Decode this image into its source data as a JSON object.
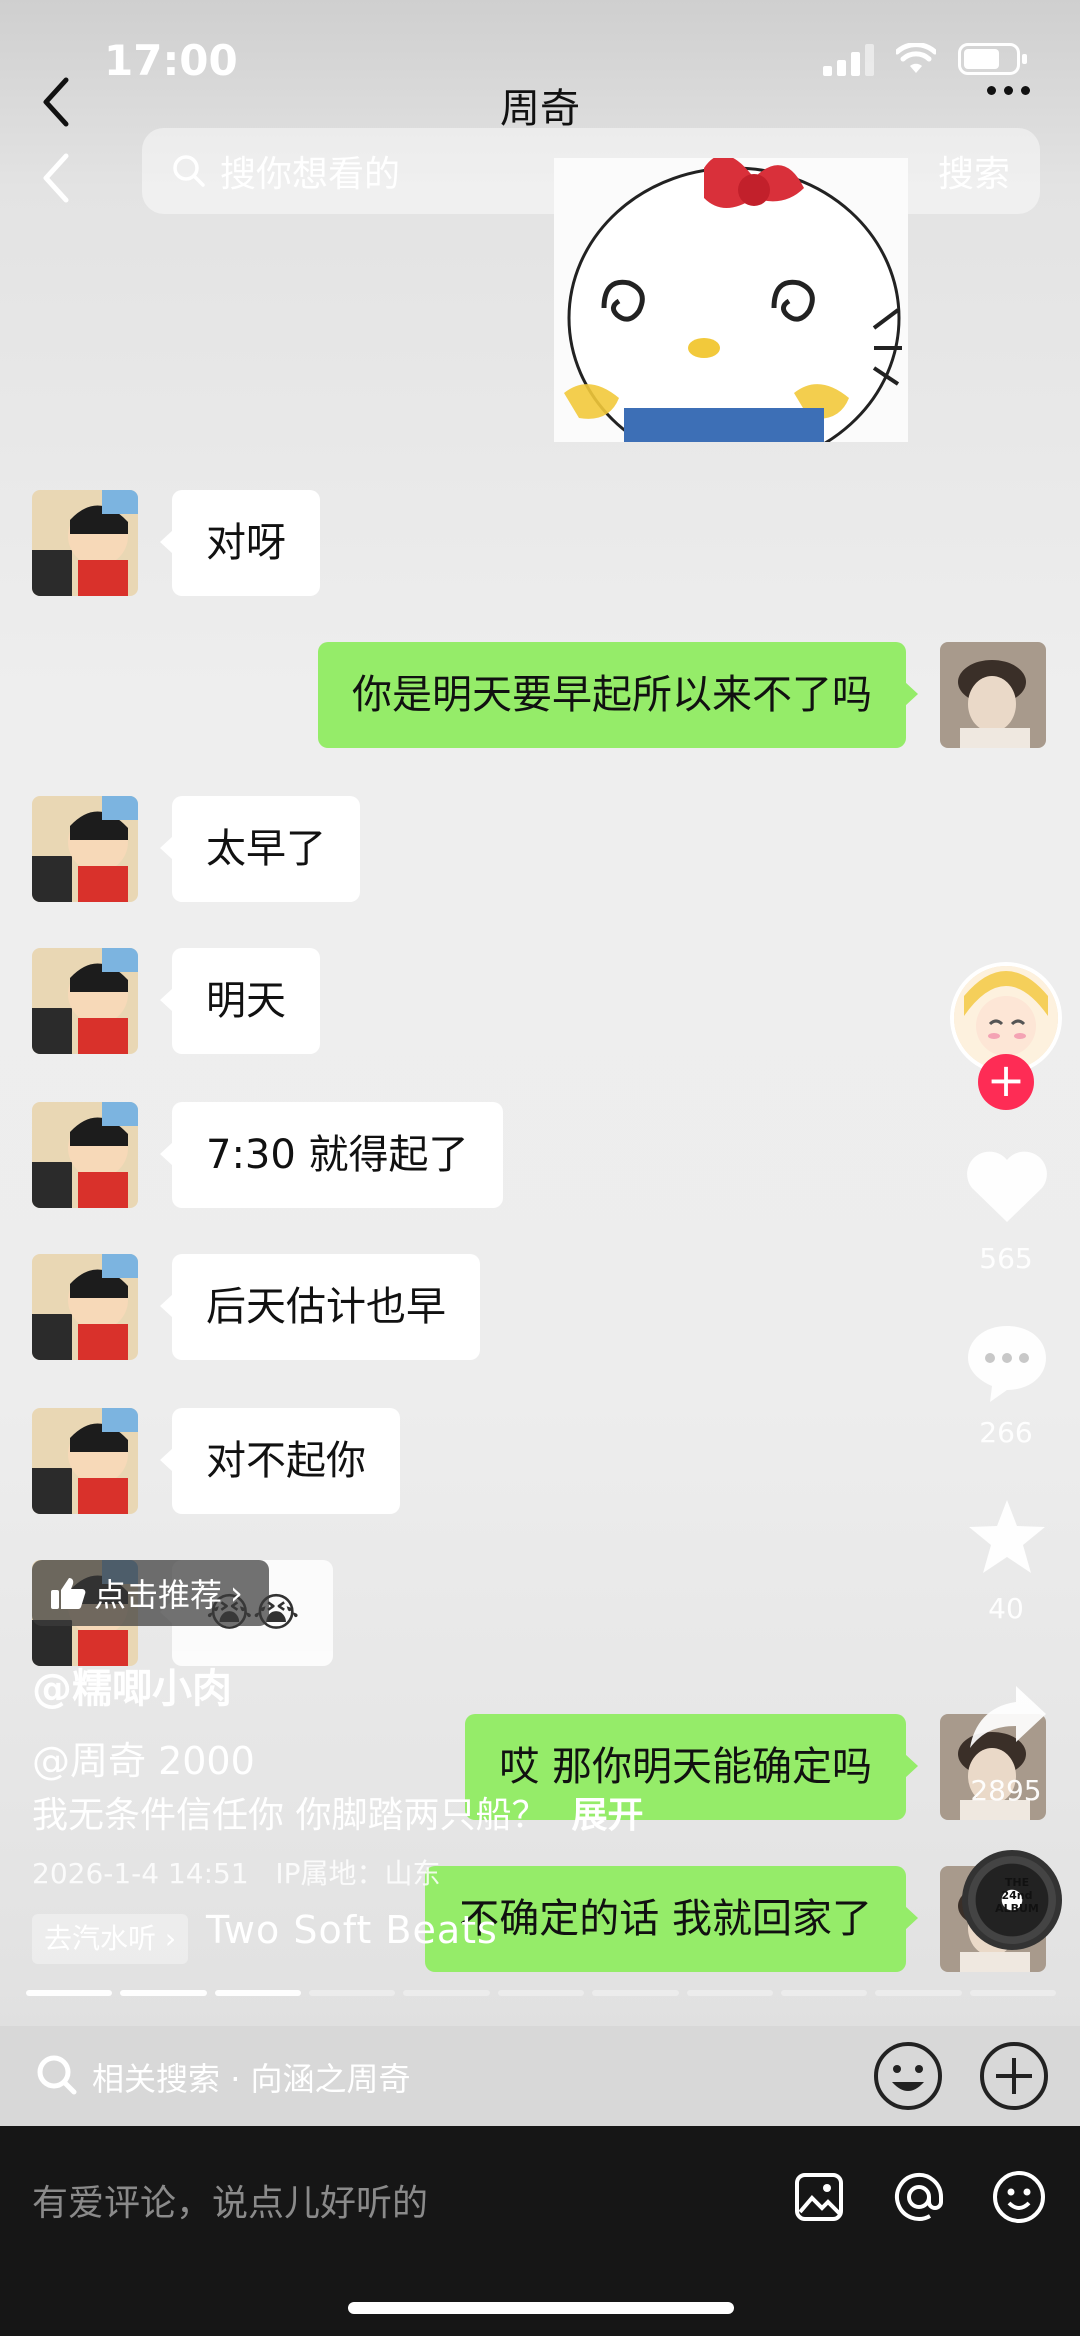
{
  "status_bar": {
    "time": "17:00"
  },
  "chat_header": {
    "title": "周奇"
  },
  "search": {
    "placeholder": "搜你想看的",
    "button": "搜索"
  },
  "messages": [
    {
      "side": "in",
      "text": "对呀"
    },
    {
      "side": "out",
      "text": "你是明天要早起所以来不了吗"
    },
    {
      "side": "in",
      "text": "太早了"
    },
    {
      "side": "in",
      "text": "明天"
    },
    {
      "side": "in",
      "text": "7:30 就得起了"
    },
    {
      "side": "in",
      "text": "后天估计也早"
    },
    {
      "side": "in",
      "text": "对不起你"
    },
    {
      "side": "in",
      "text": "😭😭"
    },
    {
      "side": "out",
      "text": "哎 那你明天能确定吗"
    },
    {
      "side": "out",
      "text": "不确定的话 我就回家了"
    }
  ],
  "actions": {
    "likes": "565",
    "comments": "266",
    "favorites": "40",
    "shares": "2895"
  },
  "overlay": {
    "recommend": "点击推荐",
    "author": "@糯唧小肉",
    "mention": "@周奇 2000",
    "description": "我无条件信任你 你脚踏两只船？",
    "expand": "展开",
    "timestamp": "2026-1-4 14:51",
    "ip_location": "IP属地：山东",
    "music_tag": "去汽水听",
    "music_title": "Two Soft Beats",
    "album_label": "THE 24nd ALBUM"
  },
  "progress": {
    "total_segments": 11,
    "done_segments": 3
  },
  "related_search": {
    "label": "相关搜索",
    "query": "向涵之周奇"
  },
  "comment_bar": {
    "placeholder": "有爱评论，说点儿好听的"
  },
  "colors": {
    "out_bubble": "#95ec69",
    "in_bubble": "#ffffff",
    "follow": "#fe2c55",
    "comment_bar": "#161616"
  }
}
